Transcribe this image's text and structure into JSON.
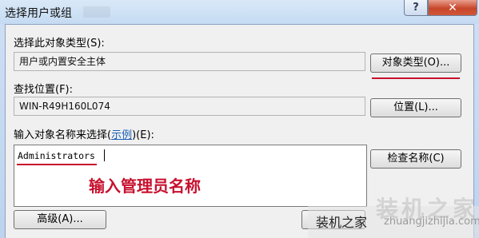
{
  "window": {
    "title": "选择用户或组",
    "help_label": "?",
    "close_label": "✕"
  },
  "object_type": {
    "label": "选择此对象类型(S):",
    "value": "用户或内置安全主体",
    "button": "对象类型(O)..."
  },
  "location": {
    "label": "查找位置(F):",
    "value": "WIN-R49H160L074",
    "button": "位置(L)..."
  },
  "names": {
    "label_prefix": "输入对象名称来选择(",
    "label_link": "示例",
    "label_suffix": ")(E):",
    "value": "Administrators",
    "check_button": "检查名称(C)"
  },
  "annotation": "输入管理员名称",
  "advanced_button": "高级(A)...",
  "watermark": {
    "text": "装机之家",
    "big": "装机之家",
    "url": "zhuangjizhijia.com"
  },
  "colors": {
    "annotation": "#c8102e",
    "link": "#1a5fb4"
  }
}
